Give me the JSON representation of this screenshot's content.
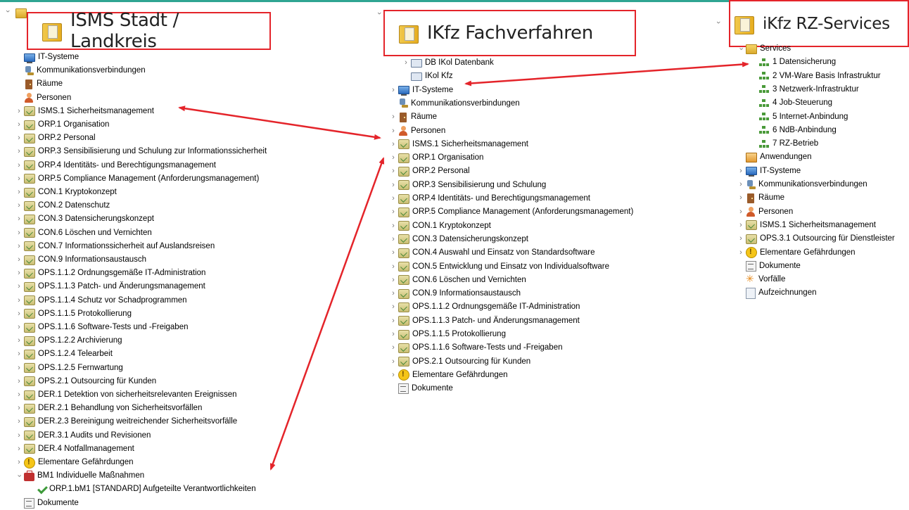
{
  "panel1": {
    "title": "ISMS Stadt / Landkreis",
    "items": [
      {
        "label": "IT-Systeme",
        "icon": "it-system-icon",
        "exp": ""
      },
      {
        "label": "Kommunikationsverbindungen",
        "icon": "kommunikation-icon",
        "exp": ""
      },
      {
        "label": "Räume",
        "icon": "raum-icon",
        "exp": ""
      },
      {
        "label": "Personen",
        "icon": "person-icon",
        "exp": ""
      },
      {
        "label": "ISMS.1 Sicherheitsmanagement",
        "icon": "baustein-icon",
        "exp": "c"
      },
      {
        "label": "ORP.1 Organisation",
        "icon": "baustein-icon",
        "exp": "c"
      },
      {
        "label": "ORP.2 Personal",
        "icon": "baustein-icon",
        "exp": "c"
      },
      {
        "label": "ORP.3 Sensibilisierung und Schulung zur Informationssicherheit",
        "icon": "baustein-icon",
        "exp": "c"
      },
      {
        "label": "ORP.4 Identitäts- und Berechtigungsmanagement",
        "icon": "baustein-icon",
        "exp": "c"
      },
      {
        "label": "ORP.5 Compliance Management (Anforderungsmanagement)",
        "icon": "baustein-icon",
        "exp": "c"
      },
      {
        "label": "CON.1 Kryptokonzept",
        "icon": "baustein-icon",
        "exp": "c"
      },
      {
        "label": "CON.2 Datenschutz",
        "icon": "baustein-icon",
        "exp": "c"
      },
      {
        "label": "CON.3 Datensicherungskonzept",
        "icon": "baustein-icon",
        "exp": "c"
      },
      {
        "label": "CON.6 Löschen und Vernichten",
        "icon": "baustein-icon",
        "exp": "c"
      },
      {
        "label": "CON.7 Informationssicherheit auf Auslandsreisen",
        "icon": "baustein-icon",
        "exp": "c"
      },
      {
        "label": "CON.9 Informationsaustausch",
        "icon": "baustein-icon",
        "exp": "c"
      },
      {
        "label": "OPS.1.1.2 Ordnungsgemäße IT-Administration",
        "icon": "baustein-icon",
        "exp": "c"
      },
      {
        "label": "OPS.1.1.3 Patch- und Änderungsmanagement",
        "icon": "baustein-icon",
        "exp": "c"
      },
      {
        "label": "OPS.1.1.4 Schutz vor Schadprogrammen",
        "icon": "baustein-icon",
        "exp": "c"
      },
      {
        "label": "OPS.1.1.5 Protokollierung",
        "icon": "baustein-icon",
        "exp": "c"
      },
      {
        "label": "OPS.1.1.6 Software-Tests und -Freigaben",
        "icon": "baustein-icon",
        "exp": "c"
      },
      {
        "label": "OPS.1.2.2 Archivierung",
        "icon": "baustein-icon",
        "exp": "c"
      },
      {
        "label": "OPS.1.2.4 Telearbeit",
        "icon": "baustein-icon",
        "exp": "c"
      },
      {
        "label": "OPS.1.2.5 Fernwartung",
        "icon": "baustein-icon",
        "exp": "c"
      },
      {
        "label": "OPS.2.1 Outsourcing für Kunden",
        "icon": "baustein-icon",
        "exp": "c"
      },
      {
        "label": "DER.1 Detektion von sicherheitsrelevanten Ereignissen",
        "icon": "baustein-icon",
        "exp": "c"
      },
      {
        "label": "DER.2.1 Behandlung von Sicherheitsvorfällen",
        "icon": "baustein-icon",
        "exp": "c"
      },
      {
        "label": "DER.2.3 Bereinigung weitreichender Sicherheitsvorfälle",
        "icon": "baustein-icon",
        "exp": "c"
      },
      {
        "label": "DER.3.1 Audits und Revisionen",
        "icon": "baustein-icon",
        "exp": "c"
      },
      {
        "label": "DER.4 Notfallmanagement",
        "icon": "baustein-icon",
        "exp": "c"
      },
      {
        "label": "Elementare Gefährdungen",
        "icon": "gefaehrdung-icon",
        "exp": "c"
      },
      {
        "label": "BM1 Individuelle Maßnahmen",
        "icon": "massnahme-icon",
        "exp": "o"
      },
      {
        "label": "ORP.1.bM1 [STANDARD] Aufgeteilte Verantwortlichkeiten",
        "icon": "check-icon",
        "exp": "",
        "indent": 1
      },
      {
        "label": "Dokumente",
        "icon": "dokument-icon",
        "exp": ""
      }
    ]
  },
  "panel2": {
    "title": "IKfz Fachverfahren",
    "items": [
      {
        "label": "DB IKol Datenbank",
        "icon": "datenbank-icon",
        "exp": "c",
        "indent": 1
      },
      {
        "label": "IKol Kfz",
        "icon": "datenbank-icon",
        "exp": "",
        "indent": 1
      },
      {
        "label": "IT-Systeme",
        "icon": "it-system-icon",
        "exp": "c"
      },
      {
        "label": "Kommunikationsverbindungen",
        "icon": "kommunikation-icon",
        "exp": ""
      },
      {
        "label": "Räume",
        "icon": "raum-icon",
        "exp": "c"
      },
      {
        "label": "Personen",
        "icon": "person-icon",
        "exp": "c"
      },
      {
        "label": "ISMS.1 Sicherheitsmanagement",
        "icon": "baustein-icon",
        "exp": "c"
      },
      {
        "label": "ORP.1 Organisation",
        "icon": "baustein-icon",
        "exp": "c"
      },
      {
        "label": "ORP.2 Personal",
        "icon": "baustein-icon",
        "exp": "c"
      },
      {
        "label": "ORP.3 Sensibilisierung und Schulung",
        "icon": "baustein-icon",
        "exp": "c"
      },
      {
        "label": "ORP.4 Identitäts- und Berechtigungsmanagement",
        "icon": "baustein-icon",
        "exp": "c"
      },
      {
        "label": "ORP.5 Compliance Management (Anforderungsmanagement)",
        "icon": "baustein-icon",
        "exp": "c"
      },
      {
        "label": "CON.1 Kryptokonzept",
        "icon": "baustein-icon",
        "exp": "c"
      },
      {
        "label": "CON.3 Datensicherungskonzept",
        "icon": "baustein-icon",
        "exp": "c"
      },
      {
        "label": "CON.4 Auswahl und Einsatz von Standardsoftware",
        "icon": "baustein-icon",
        "exp": "c"
      },
      {
        "label": "CON.5 Entwicklung und Einsatz von Individualsoftware",
        "icon": "baustein-icon",
        "exp": "c"
      },
      {
        "label": "CON.6 Löschen und Vernichten",
        "icon": "baustein-icon",
        "exp": "c"
      },
      {
        "label": "CON.9 Informationsaustausch",
        "icon": "baustein-icon",
        "exp": "c"
      },
      {
        "label": "OPS.1.1.2 Ordnungsgemäße IT-Administration",
        "icon": "baustein-icon",
        "exp": "c"
      },
      {
        "label": "OPS.1.1.3 Patch- und Änderungsmanagement",
        "icon": "baustein-icon",
        "exp": "c"
      },
      {
        "label": "OPS.1.1.5 Protokollierung",
        "icon": "baustein-icon",
        "exp": "c"
      },
      {
        "label": "OPS.1.1.6 Software-Tests und -Freigaben",
        "icon": "baustein-icon",
        "exp": "c"
      },
      {
        "label": "OPS.2.1 Outsourcing für Kunden",
        "icon": "baustein-icon",
        "exp": "c"
      },
      {
        "label": "Elementare Gefährdungen",
        "icon": "gefaehrdung-icon",
        "exp": "c"
      },
      {
        "label": "Dokumente",
        "icon": "dokument-icon",
        "exp": ""
      }
    ]
  },
  "panel3": {
    "title": "iKfz RZ-Services",
    "items": [
      {
        "label": "Services",
        "icon": "services-icon",
        "exp": "o"
      },
      {
        "label": "1 Datensicherung",
        "icon": "service-icon",
        "exp": "",
        "indent": 1
      },
      {
        "label": "2 VM-Ware Basis Infrastruktur",
        "icon": "service-icon",
        "exp": "",
        "indent": 1
      },
      {
        "label": "3 Netzwerk-Infrastruktur",
        "icon": "service-icon",
        "exp": "",
        "indent": 1
      },
      {
        "label": "4 Job-Steuerung",
        "icon": "service-icon",
        "exp": "",
        "indent": 1
      },
      {
        "label": "5 Internet-Anbindung",
        "icon": "service-icon",
        "exp": "",
        "indent": 1
      },
      {
        "label": "6 NdB-Anbindung",
        "icon": "service-icon",
        "exp": "",
        "indent": 1
      },
      {
        "label": "7 RZ-Betrieb",
        "icon": "service-icon",
        "exp": "",
        "indent": 1
      },
      {
        "label": "Anwendungen",
        "icon": "anwendung-icon",
        "exp": ""
      },
      {
        "label": "IT-Systeme",
        "icon": "it-system-icon",
        "exp": "c"
      },
      {
        "label": "Kommunikationsverbindungen",
        "icon": "kommunikation-icon",
        "exp": "c"
      },
      {
        "label": "Räume",
        "icon": "raum-icon",
        "exp": "c"
      },
      {
        "label": "Personen",
        "icon": "person-icon",
        "exp": "c"
      },
      {
        "label": "ISMS.1 Sicherheitsmanagement",
        "icon": "baustein-icon",
        "exp": "c"
      },
      {
        "label": "OPS.3.1 Outsourcing für Dienstleister",
        "icon": "baustein-icon",
        "exp": "c"
      },
      {
        "label": "Elementare Gefährdungen",
        "icon": "gefaehrdung-icon",
        "exp": "c"
      },
      {
        "label": "Dokumente",
        "icon": "dokument-icon",
        "exp": ""
      },
      {
        "label": "Vorfälle",
        "icon": "vorfall-icon",
        "exp": ""
      },
      {
        "label": "Aufzeichnungen",
        "icon": "aufzeichnung-icon",
        "exp": ""
      }
    ]
  },
  "colors": {
    "highlight_box": "#e4242a",
    "arrow": "#e4242a",
    "top_accent": "#2fa592"
  }
}
